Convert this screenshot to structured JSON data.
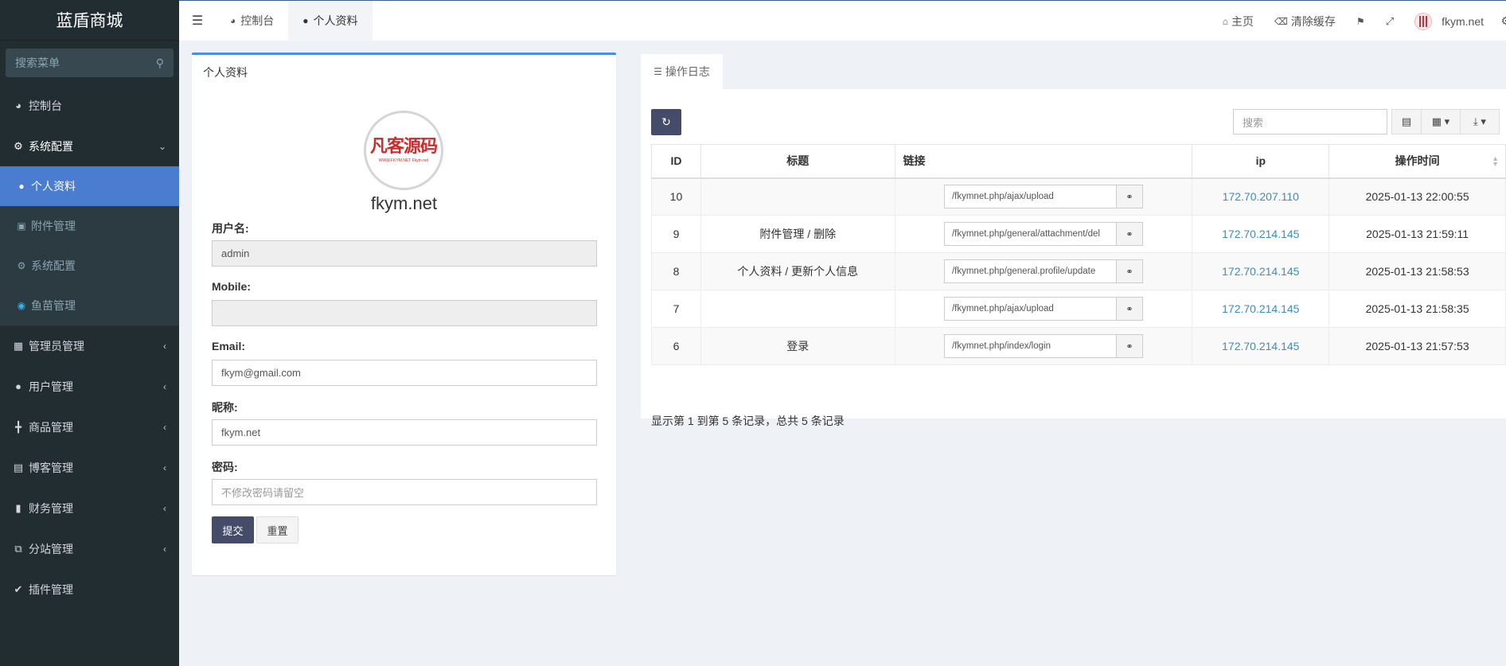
{
  "brand": "蓝盾商城",
  "sidebar": {
    "search_placeholder": "搜索菜单",
    "items": [
      {
        "label": "控制台",
        "icon": "dashboard-icon"
      },
      {
        "label": "系统配置",
        "icon": "cogs-icon"
      },
      {
        "label": "管理员管理",
        "icon": "windows-icon"
      },
      {
        "label": "用户管理",
        "icon": "user-icon"
      },
      {
        "label": "商品管理",
        "icon": "cart-icon"
      },
      {
        "label": "博客管理",
        "icon": "book-icon"
      },
      {
        "label": "财务管理",
        "icon": "bookmark-icon"
      },
      {
        "label": "分站管理",
        "icon": "clone-icon"
      },
      {
        "label": "插件管理",
        "icon": "plug-icon"
      }
    ],
    "submenu": [
      {
        "label": "个人资料",
        "icon": "user-icon",
        "active": true
      },
      {
        "label": "附件管理",
        "icon": "image-icon"
      },
      {
        "label": "系统配置",
        "icon": "gear-icon"
      },
      {
        "label": "鱼苗管理",
        "icon": "fish-icon"
      }
    ]
  },
  "topbar": {
    "tabs": [
      {
        "label": "控制台",
        "icon": "dashboard-icon"
      },
      {
        "label": "个人资料",
        "icon": "user-icon",
        "active": true
      }
    ],
    "home": "主页",
    "clear_cache": "清除缓存",
    "username": "fkym.net"
  },
  "profile": {
    "panel_title": "个人资料",
    "avatar_text": "凡客源码",
    "avatar_subtext": "WWW.FKYM.NET Fkym.net",
    "display_name": "fkym.net",
    "username_label": "用户名:",
    "username_value": "admin",
    "mobile_label": "Mobile:",
    "mobile_value": "",
    "email_label": "Email:",
    "email_value": "fkym@gmail.com",
    "nickname_label": "昵称:",
    "nickname_value": "fkym.net",
    "password_label": "密码:",
    "password_placeholder": "不修改密码请留空",
    "submit": "提交",
    "reset": "重置"
  },
  "log": {
    "tab_label": "操作日志",
    "search_placeholder": "搜索",
    "columns": [
      "ID",
      "标题",
      "链接",
      "ip",
      "操作时间"
    ],
    "rows": [
      {
        "id": "10",
        "title": "",
        "url": "/fkymnet.php/ajax/upload",
        "ip": "172.70.207.110",
        "time": "2025-01-13 22:00:55"
      },
      {
        "id": "9",
        "title": "附件管理 / 删除",
        "url": "/fkymnet.php/general/attachment/del",
        "ip": "172.70.214.145",
        "time": "2025-01-13 21:59:11"
      },
      {
        "id": "8",
        "title": "个人资料 / 更新个人信息",
        "url": "/fkymnet.php/general.profile/update",
        "ip": "172.70.214.145",
        "time": "2025-01-13 21:58:53"
      },
      {
        "id": "7",
        "title": "",
        "url": "/fkymnet.php/ajax/upload",
        "ip": "172.70.214.145",
        "time": "2025-01-13 21:58:35"
      },
      {
        "id": "6",
        "title": "登录",
        "url": "/fkymnet.php/index/login",
        "ip": "172.70.214.145",
        "time": "2025-01-13 21:57:53"
      }
    ],
    "info": "显示第 1 到第 5 条记录，总共 5 条记录"
  }
}
